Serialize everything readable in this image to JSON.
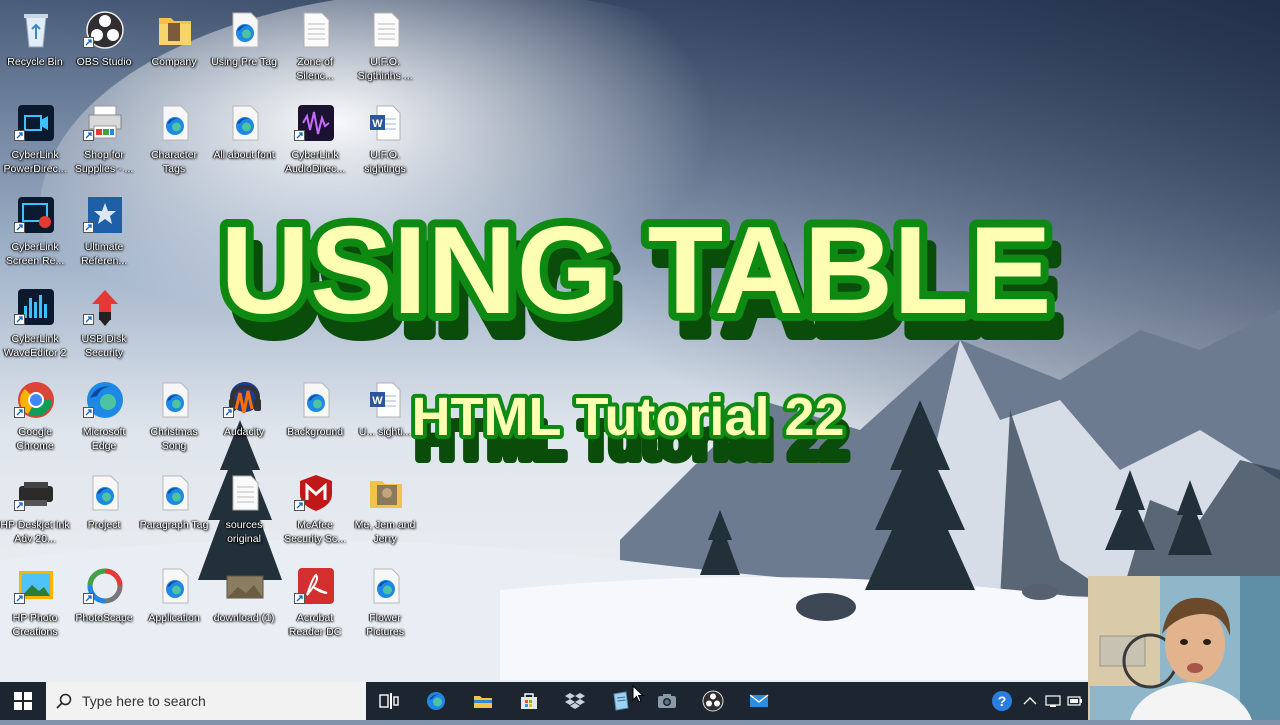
{
  "desktop": {
    "icons": [
      {
        "label": "Recycle Bin",
        "icon": "recycle-bin-icon",
        "col": 0,
        "row": 0
      },
      {
        "label": "OBS Studio",
        "icon": "obs-studio-icon",
        "col": 1,
        "row": 0
      },
      {
        "label": "Company",
        "icon": "folder-icon",
        "col": 2,
        "row": 0
      },
      {
        "label": "Using Pre Tag",
        "icon": "edge-html-file-icon",
        "col": 3,
        "row": 0
      },
      {
        "label": "Zone of Silenc...",
        "icon": "text-file-icon",
        "col": 4,
        "row": 0
      },
      {
        "label": "U.F.O. Sigthinhs ...",
        "icon": "text-file-icon",
        "col": 5,
        "row": 0
      },
      {
        "label": "CyberLink PowerDirec...",
        "icon": "powerdirector-icon",
        "col": 0,
        "row": 1
      },
      {
        "label": "Shop for Supplies - ...",
        "icon": "printer-icon",
        "col": 1,
        "row": 1
      },
      {
        "label": "Character Tags",
        "icon": "edge-html-file-icon",
        "col": 2,
        "row": 1
      },
      {
        "label": "All about font",
        "icon": "edge-html-file-icon",
        "col": 3,
        "row": 1
      },
      {
        "label": "CyberLink AudioDirec...",
        "icon": "audiodirector-icon",
        "col": 4,
        "row": 1
      },
      {
        "label": "U.F.O. sightings",
        "icon": "word-document-icon",
        "col": 5,
        "row": 1
      },
      {
        "label": "CyberLink Screen Re...",
        "icon": "screen-recorder-icon",
        "col": 0,
        "row": 2
      },
      {
        "label": "Ultimate Referen...",
        "icon": "reference-book-icon",
        "col": 1,
        "row": 2
      },
      {
        "label": "CyberLink WaveEditor 2",
        "icon": "waveeditor-icon",
        "col": 0,
        "row": 3
      },
      {
        "label": "USB Disk Security",
        "icon": "usb-security-icon",
        "col": 1,
        "row": 3
      },
      {
        "label": "Google Chrome",
        "icon": "chrome-icon",
        "col": 0,
        "row": 4
      },
      {
        "label": "Microsoft Edge",
        "icon": "edge-icon",
        "col": 1,
        "row": 4
      },
      {
        "label": "Christmas Song",
        "icon": "edge-html-file-icon",
        "col": 2,
        "row": 4
      },
      {
        "label": "Audacity",
        "icon": "audacity-icon",
        "col": 3,
        "row": 4
      },
      {
        "label": "Background",
        "icon": "edge-html-file-icon",
        "col": 4,
        "row": 4
      },
      {
        "label": "U... sighti...",
        "icon": "word-document-icon",
        "col": 5,
        "row": 4
      },
      {
        "label": "HP Deskjet Ink Adv 20...",
        "icon": "hp-printer-icon",
        "col": 0,
        "row": 5
      },
      {
        "label": "Project",
        "icon": "edge-html-file-icon",
        "col": 1,
        "row": 5
      },
      {
        "label": "Paragraph Tag",
        "icon": "edge-html-file-icon",
        "col": 2,
        "row": 5
      },
      {
        "label": "sources original",
        "icon": "text-file-icon",
        "col": 3,
        "row": 5
      },
      {
        "label": "McAfee Security Sc...",
        "icon": "mcafee-icon",
        "col": 4,
        "row": 5
      },
      {
        "label": "Me, Jem and Jerry",
        "icon": "photo-folder-icon",
        "col": 5,
        "row": 5
      },
      {
        "label": "HP Photo Creations",
        "icon": "hp-photo-icon",
        "col": 0,
        "row": 6
      },
      {
        "label": "PhotoScape",
        "icon": "photoscape-icon",
        "col": 1,
        "row": 6
      },
      {
        "label": "Application",
        "icon": "edge-html-file-icon",
        "col": 2,
        "row": 6
      },
      {
        "label": "download (1)",
        "icon": "image-file-icon",
        "col": 3,
        "row": 6
      },
      {
        "label": "Acrobat Reader DC",
        "icon": "acrobat-icon",
        "col": 4,
        "row": 6
      },
      {
        "label": "Flower Pictures",
        "icon": "edge-html-file-icon",
        "col": 5,
        "row": 6
      }
    ]
  },
  "overlay": {
    "title": "USING TABLE",
    "subtitle": "HTML Tutorial 22",
    "colors": {
      "fill": "#ffffb4",
      "outline": "#0e8a12",
      "shadow": "#0a4d0a"
    }
  },
  "taskbar": {
    "search_placeholder": "Type here to search",
    "apps": [
      "task-view-icon",
      "edge-icon",
      "file-explorer-icon",
      "store-icon",
      "dropbox-icon",
      "notepad-icon",
      "camera-icon",
      "obs-studio-icon",
      "mail-icon"
    ],
    "tray": [
      "help-icon",
      "chevron-up-icon",
      "network-icon",
      "battery-icon"
    ]
  },
  "colors": {
    "taskbar": "#1d2630",
    "search_box": "#f2f2f2"
  }
}
